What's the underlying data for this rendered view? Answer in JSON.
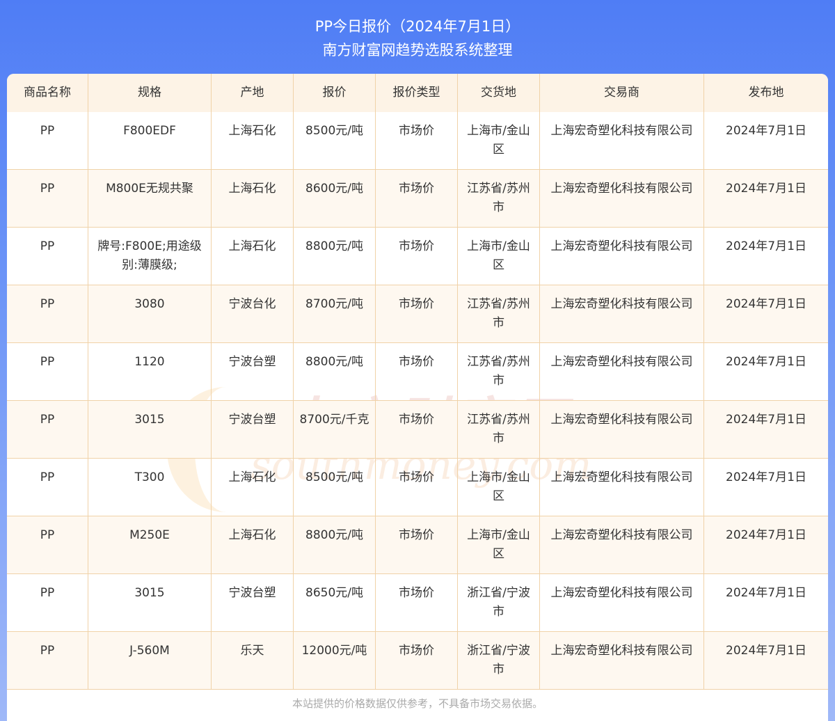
{
  "header": {
    "title": "PP今日报价（2024年7月1日）",
    "subtitle": "南方财富网趋势选股系统整理"
  },
  "watermark": {
    "cn": "南方财富网",
    "en": "southmoney.com"
  },
  "table": {
    "columns": [
      "商品名称",
      "规格",
      "产地",
      "报价",
      "报价类型",
      "交货地",
      "交易商",
      "发布地"
    ],
    "rows": [
      [
        "PP",
        "F800EDF",
        "上海石化",
        "8500元/吨",
        "市场价",
        "上海市/金山区",
        "上海宏奇塑化科技有限公司",
        "2024年7月1日"
      ],
      [
        "PP",
        "M800E无规共聚",
        "上海石化",
        "8600元/吨",
        "市场价",
        "江苏省/苏州市",
        "上海宏奇塑化科技有限公司",
        "2024年7月1日"
      ],
      [
        "PP",
        "牌号:F800E;用途级别:薄膜级;",
        "上海石化",
        "8800元/吨",
        "市场价",
        "上海市/金山区",
        "上海宏奇塑化科技有限公司",
        "2024年7月1日"
      ],
      [
        "PP",
        "3080",
        "宁波台化",
        "8700元/吨",
        "市场价",
        "江苏省/苏州市",
        "上海宏奇塑化科技有限公司",
        "2024年7月1日"
      ],
      [
        "PP",
        "1120",
        "宁波台塑",
        "8800元/吨",
        "市场价",
        "江苏省/苏州市",
        "上海宏奇塑化科技有限公司",
        "2024年7月1日"
      ],
      [
        "PP",
        "3015",
        "宁波台塑",
        "8700元/千克",
        "市场价",
        "江苏省/苏州市",
        "上海宏奇塑化科技有限公司",
        "2024年7月1日"
      ],
      [
        "PP",
        "T300",
        "上海石化",
        "8500元/吨",
        "市场价",
        "上海市/金山区",
        "上海宏奇塑化科技有限公司",
        "2024年7月1日"
      ],
      [
        "PP",
        "M250E",
        "上海石化",
        "8800元/吨",
        "市场价",
        "上海市/金山区",
        "上海宏奇塑化科技有限公司",
        "2024年7月1日"
      ],
      [
        "PP",
        "3015",
        "宁波台塑",
        "8650元/吨",
        "市场价",
        "浙江省/宁波市",
        "上海宏奇塑化科技有限公司",
        "2024年7月1日"
      ],
      [
        "PP",
        "J-560M",
        "乐天",
        "12000元/吨",
        "市场价",
        "浙江省/宁波市",
        "上海宏奇塑化科技有限公司",
        "2024年7月1日"
      ]
    ]
  },
  "footer": {
    "disclaimer": "本站提供的价格数据仅供参考，不具备市场交易依据。"
  }
}
